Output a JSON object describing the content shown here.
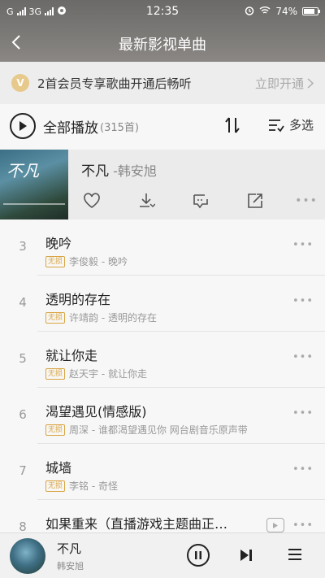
{
  "status": {
    "carrier1": "G",
    "carrier2": "3G",
    "time": "12:35",
    "battery": "74%"
  },
  "nav": {
    "title": "最新影视单曲"
  },
  "vip": {
    "text": "2首会员专享歌曲开通后畅听",
    "link": "立即开通",
    "badge": "V"
  },
  "playall": {
    "label": "全部播放",
    "count": "(315首)",
    "multi": "多选"
  },
  "current": {
    "title": "不凡",
    "artist": " -韩安旭",
    "cover_text": "不凡"
  },
  "songs": [
    {
      "num": "3",
      "title": "晚吟",
      "badge": "无损",
      "sub": "李俊毅 - 晚吟"
    },
    {
      "num": "4",
      "title": "透明的存在",
      "badge": "无损",
      "sub": "许靖韵 - 透明的存在"
    },
    {
      "num": "5",
      "title": "就让你走",
      "badge": "无损",
      "sub": "赵天宇 - 就让你走"
    },
    {
      "num": "6",
      "title": "渴望遇见(情感版)",
      "badge": "无损",
      "sub": "周深 - 谁都渴望遇见你 网台剧音乐原声带"
    },
    {
      "num": "7",
      "title": "城墙",
      "badge": "无损",
      "sub": "李铭 - 奇怪"
    },
    {
      "num": "8",
      "title": "如果重来（直播游戏主题曲正…",
      "badge": "",
      "sub": ""
    }
  ],
  "player": {
    "title": "不凡",
    "artist": "韩安旭"
  },
  "colors": {
    "accent_gold": "#d9a441",
    "vip_badge": "#e7c98c",
    "header": "#7d7b78"
  },
  "icons": {
    "back": "chevron-left-icon",
    "sort": "sort-icon",
    "multi": "multi-select-icon",
    "like": "heart-icon",
    "download": "download-icon",
    "comment": "comment-icon",
    "share": "share-icon",
    "more": "more-icon",
    "pause": "pause-icon",
    "next": "next-icon",
    "menu": "playlist-icon"
  }
}
